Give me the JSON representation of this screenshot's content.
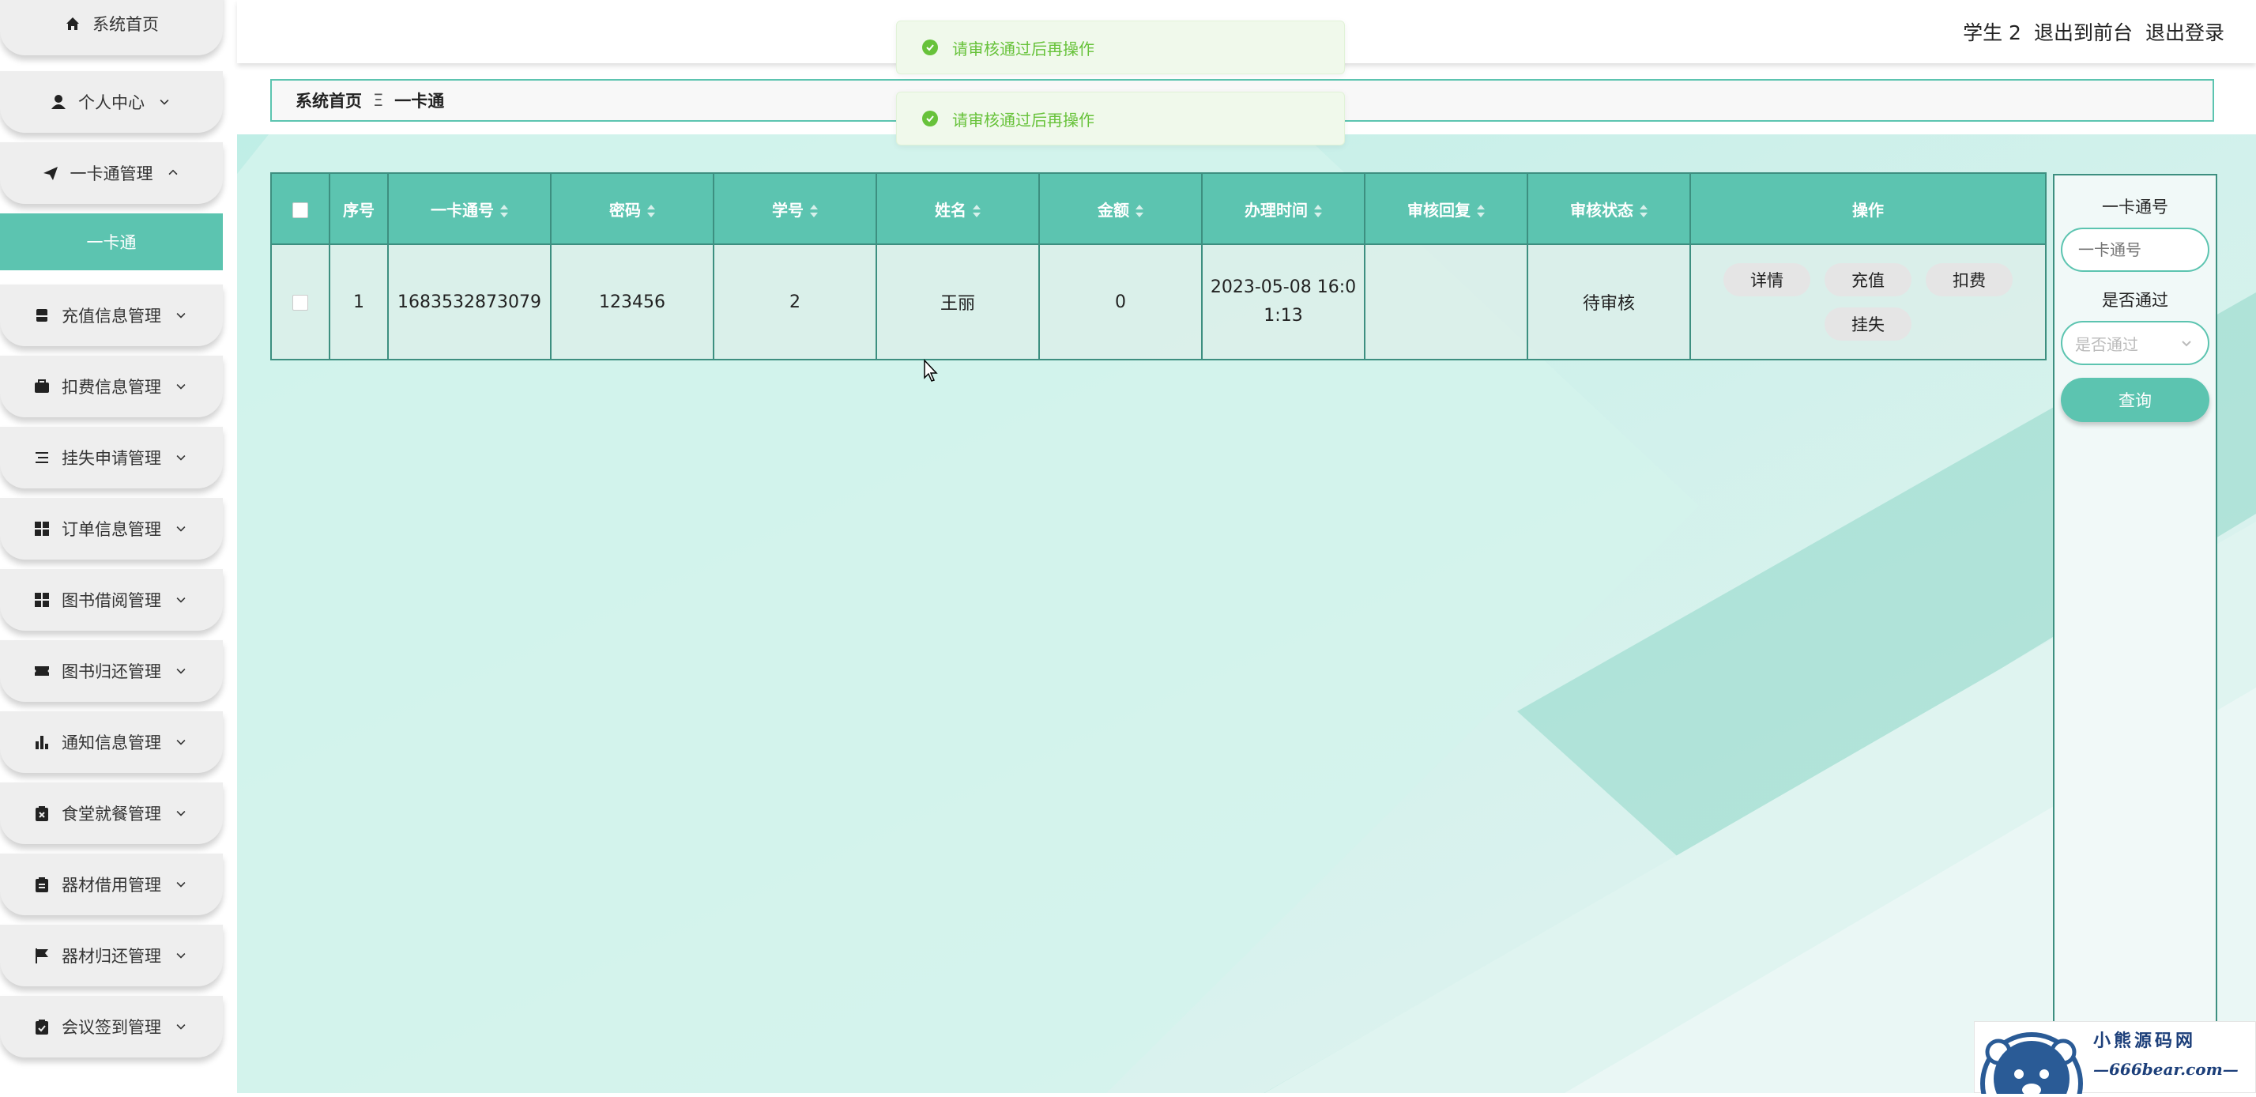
{
  "sidebar": {
    "items": [
      {
        "label": "系统首页",
        "icon": "home-icon",
        "has_chevron": false
      },
      {
        "label": "个人中心",
        "icon": "user-icon",
        "has_chevron": true
      },
      {
        "label": "一卡通管理",
        "icon": "paper-plane-icon",
        "has_chevron": true,
        "expanded": true
      },
      {
        "label": "充值信息管理",
        "icon": "wallet-icon",
        "has_chevron": true
      },
      {
        "label": "扣费信息管理",
        "icon": "briefcase-icon",
        "has_chevron": true
      },
      {
        "label": "挂失申请管理",
        "icon": "list-icon",
        "has_chevron": true
      },
      {
        "label": "订单信息管理",
        "icon": "grid-icon",
        "has_chevron": true
      },
      {
        "label": "图书借阅管理",
        "icon": "grid-icon",
        "has_chevron": true
      },
      {
        "label": "图书归还管理",
        "icon": "ticket-icon",
        "has_chevron": true
      },
      {
        "label": "通知信息管理",
        "icon": "bar-chart-icon",
        "has_chevron": true
      },
      {
        "label": "食堂就餐管理",
        "icon": "clipboard-x-icon",
        "has_chevron": true
      },
      {
        "label": "器材借用管理",
        "icon": "clipboard-icon",
        "has_chevron": true
      },
      {
        "label": "器材归还管理",
        "icon": "flag-icon",
        "has_chevron": true
      },
      {
        "label": "会议签到管理",
        "icon": "clipboard-check-icon",
        "has_chevron": true
      }
    ],
    "sub_item": "一卡通"
  },
  "header": {
    "user": "学生 2",
    "to_front": "退出到前台",
    "logout": "退出登录"
  },
  "breadcrumb": {
    "home": "系统首页",
    "separator": "Ξ",
    "current": "一卡通"
  },
  "toasts": [
    "请审核通过后再操作",
    "请审核通过后再操作"
  ],
  "table": {
    "headers": [
      "序号",
      "一卡通号",
      "密码",
      "学号",
      "姓名",
      "金额",
      "办理时间",
      "审核回复",
      "审核状态",
      "操作"
    ],
    "rows": [
      {
        "index": "1",
        "card_no": "1683532873079",
        "password": "123456",
        "student_no": "2",
        "name": "王丽",
        "amount": "0",
        "time_line1": "2023-05-08 16:0",
        "time_line2": "1:13",
        "reply": "",
        "status": "待审核"
      }
    ],
    "actions": [
      "详情",
      "充值",
      "扣费",
      "挂失"
    ]
  },
  "search": {
    "card_label": "一卡通号",
    "card_placeholder": "一卡通号",
    "pass_label": "是否通过",
    "pass_placeholder": "是否通过",
    "button": "查询"
  },
  "watermark": {
    "title": "小熊源码网",
    "url": "—666bear.com—"
  },
  "colors": {
    "accent": "#5cc4b0",
    "accent_dark": "#3d8f80",
    "toast_text": "#67c23a",
    "toast_bg": "#f0f9eb"
  }
}
